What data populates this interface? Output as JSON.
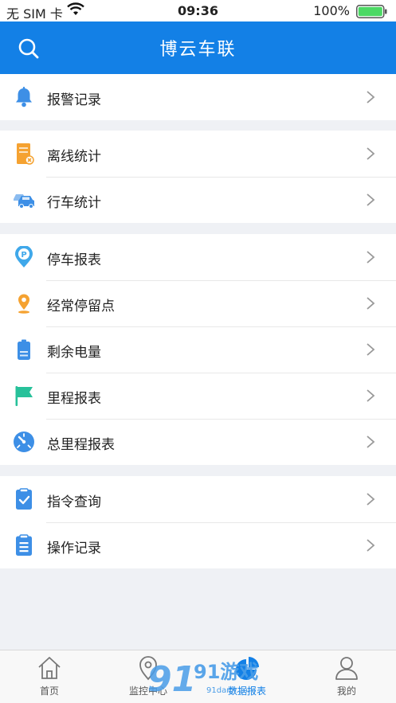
{
  "status_bar": {
    "carrier": "无 SIM 卡",
    "time": "09:36",
    "battery": "100%"
  },
  "nav": {
    "title": "博云车联",
    "search_icon": "search-icon"
  },
  "groups": [
    {
      "items": [
        {
          "label": "报警记录",
          "icon": "bell-icon"
        }
      ]
    },
    {
      "items": [
        {
          "label": "离线统计",
          "icon": "offline-icon"
        },
        {
          "label": "行车统计",
          "icon": "cars-icon"
        }
      ]
    },
    {
      "items": [
        {
          "label": "停车报表",
          "icon": "parking-icon"
        },
        {
          "label": "经常停留点",
          "icon": "location-pin-icon"
        },
        {
          "label": "剩余电量",
          "icon": "battery-icon"
        },
        {
          "label": "里程报表",
          "icon": "flag-icon"
        },
        {
          "label": "总里程报表",
          "icon": "speedometer-icon"
        }
      ]
    },
    {
      "items": [
        {
          "label": "指令查询",
          "icon": "command-check-icon"
        },
        {
          "label": "操作记录",
          "icon": "clipboard-icon"
        }
      ]
    }
  ],
  "tabs": [
    {
      "label": "首页",
      "icon": "home-icon"
    },
    {
      "label": "监控中心",
      "icon": "monitor-pin-icon"
    },
    {
      "label": "数据报表",
      "icon": "pie-chart-icon",
      "active": true
    },
    {
      "label": "我的",
      "icon": "user-icon"
    }
  ],
  "watermark": {
    "text": "91游戏",
    "sub": "91danji.com"
  },
  "colors": {
    "primary": "#1380e6",
    "bell": "#3d8fe6",
    "offline": "#f5a231",
    "parking": "#3fa8ea",
    "pin": "#f5a231",
    "battery_icon": "#3d8fe6",
    "flag": "#27c19a",
    "speedometer": "#3d8fe6",
    "command": "#3d8fe6",
    "battery_status": "#4cd964"
  }
}
